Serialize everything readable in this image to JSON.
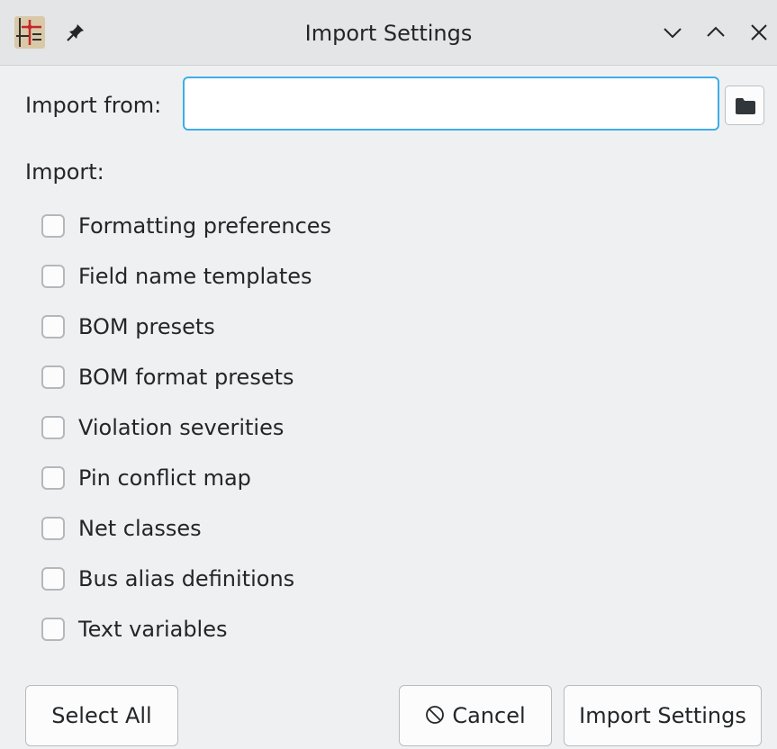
{
  "window": {
    "title": "Import Settings",
    "icons": [
      "kicad-schematic-app-icon",
      "pin-icon",
      "minimize-icon",
      "maximize-icon",
      "close-icon"
    ]
  },
  "import_from": {
    "label": "Import from:",
    "value": "",
    "placeholder": "",
    "browse_icon": "folder-icon"
  },
  "import_section": {
    "label": "Import:",
    "options": [
      {
        "label": "Formatting preferences",
        "checked": false
      },
      {
        "label": "Field name templates",
        "checked": false
      },
      {
        "label": "BOM presets",
        "checked": false
      },
      {
        "label": "BOM format presets",
        "checked": false
      },
      {
        "label": "Violation severities",
        "checked": false
      },
      {
        "label": "Pin conflict map",
        "checked": false
      },
      {
        "label": "Net classes",
        "checked": false
      },
      {
        "label": "Bus alias definitions",
        "checked": false
      },
      {
        "label": "Text variables",
        "checked": false
      }
    ]
  },
  "buttons": {
    "select_all": "Select All",
    "cancel": "Cancel",
    "cancel_icon": "cancel-circle-icon",
    "import_settings": "Import Settings"
  },
  "colors": {
    "focus_accent": "#3daee9",
    "window_bg": "#eff0f1",
    "titlebar_bg": "#e3e5e7"
  }
}
